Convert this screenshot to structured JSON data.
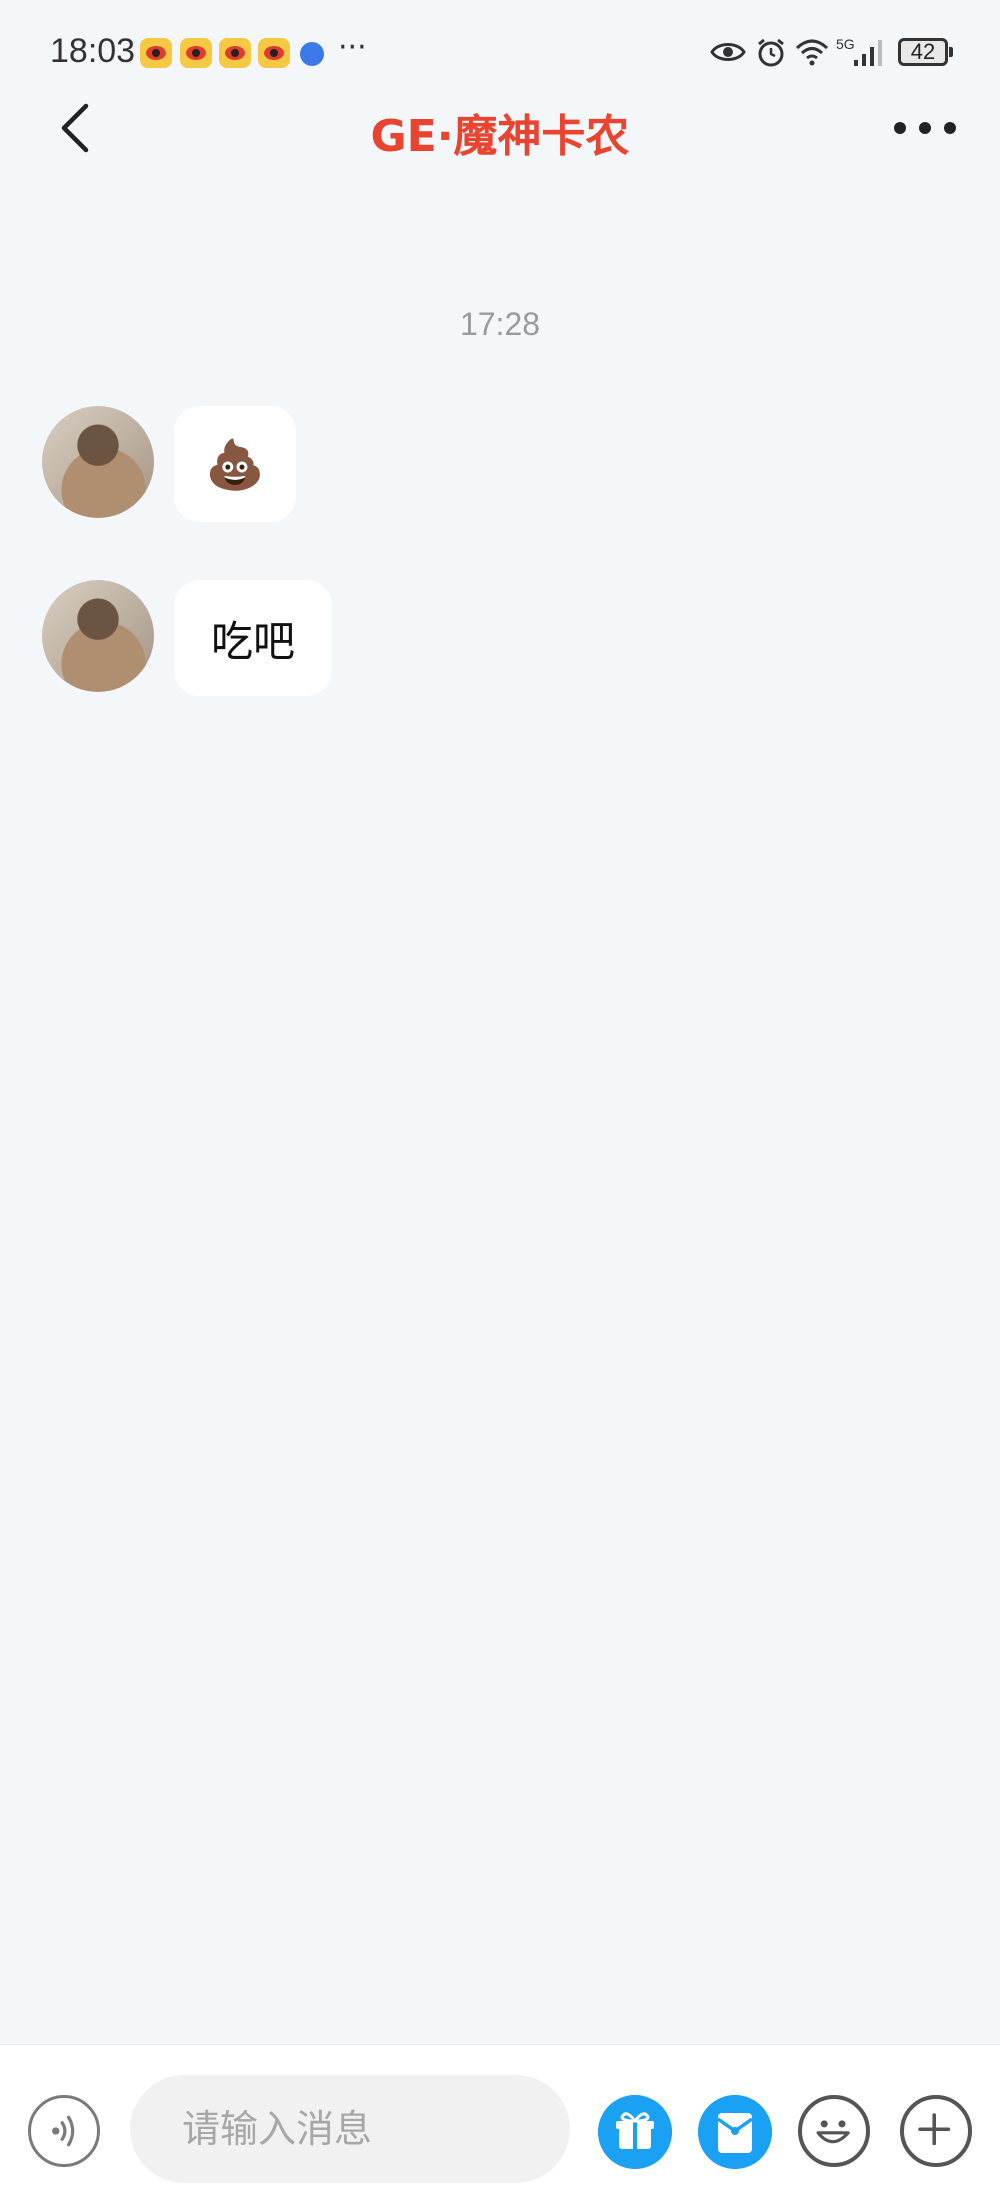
{
  "status_bar": {
    "time": "18:03",
    "overflow": "···",
    "network": "5G",
    "battery": "42",
    "icons": [
      "weibo-icon",
      "weibo-icon",
      "weibo-icon",
      "weibo-icon",
      "browser-icon",
      "eye-icon",
      "alarm-icon",
      "wifi-icon",
      "signal-icon",
      "battery-icon"
    ]
  },
  "header": {
    "title": "GE·魔神卡农",
    "back_icon": "chevron-left-icon",
    "more_icon": "more-dots-icon"
  },
  "chat": {
    "timestamp": "17:28",
    "messages": [
      {
        "type": "emoji",
        "content": "💩"
      },
      {
        "type": "text",
        "content": "吃吧"
      }
    ]
  },
  "input_bar": {
    "placeholder": "请输入消息",
    "buttons": [
      "voice-icon",
      "gift-icon",
      "red-packet-icon",
      "emoji-icon",
      "plus-icon"
    ]
  },
  "colors": {
    "title": "#e8442f",
    "accent_blue": "#1aa1f3",
    "background": "#f4f7fa"
  }
}
